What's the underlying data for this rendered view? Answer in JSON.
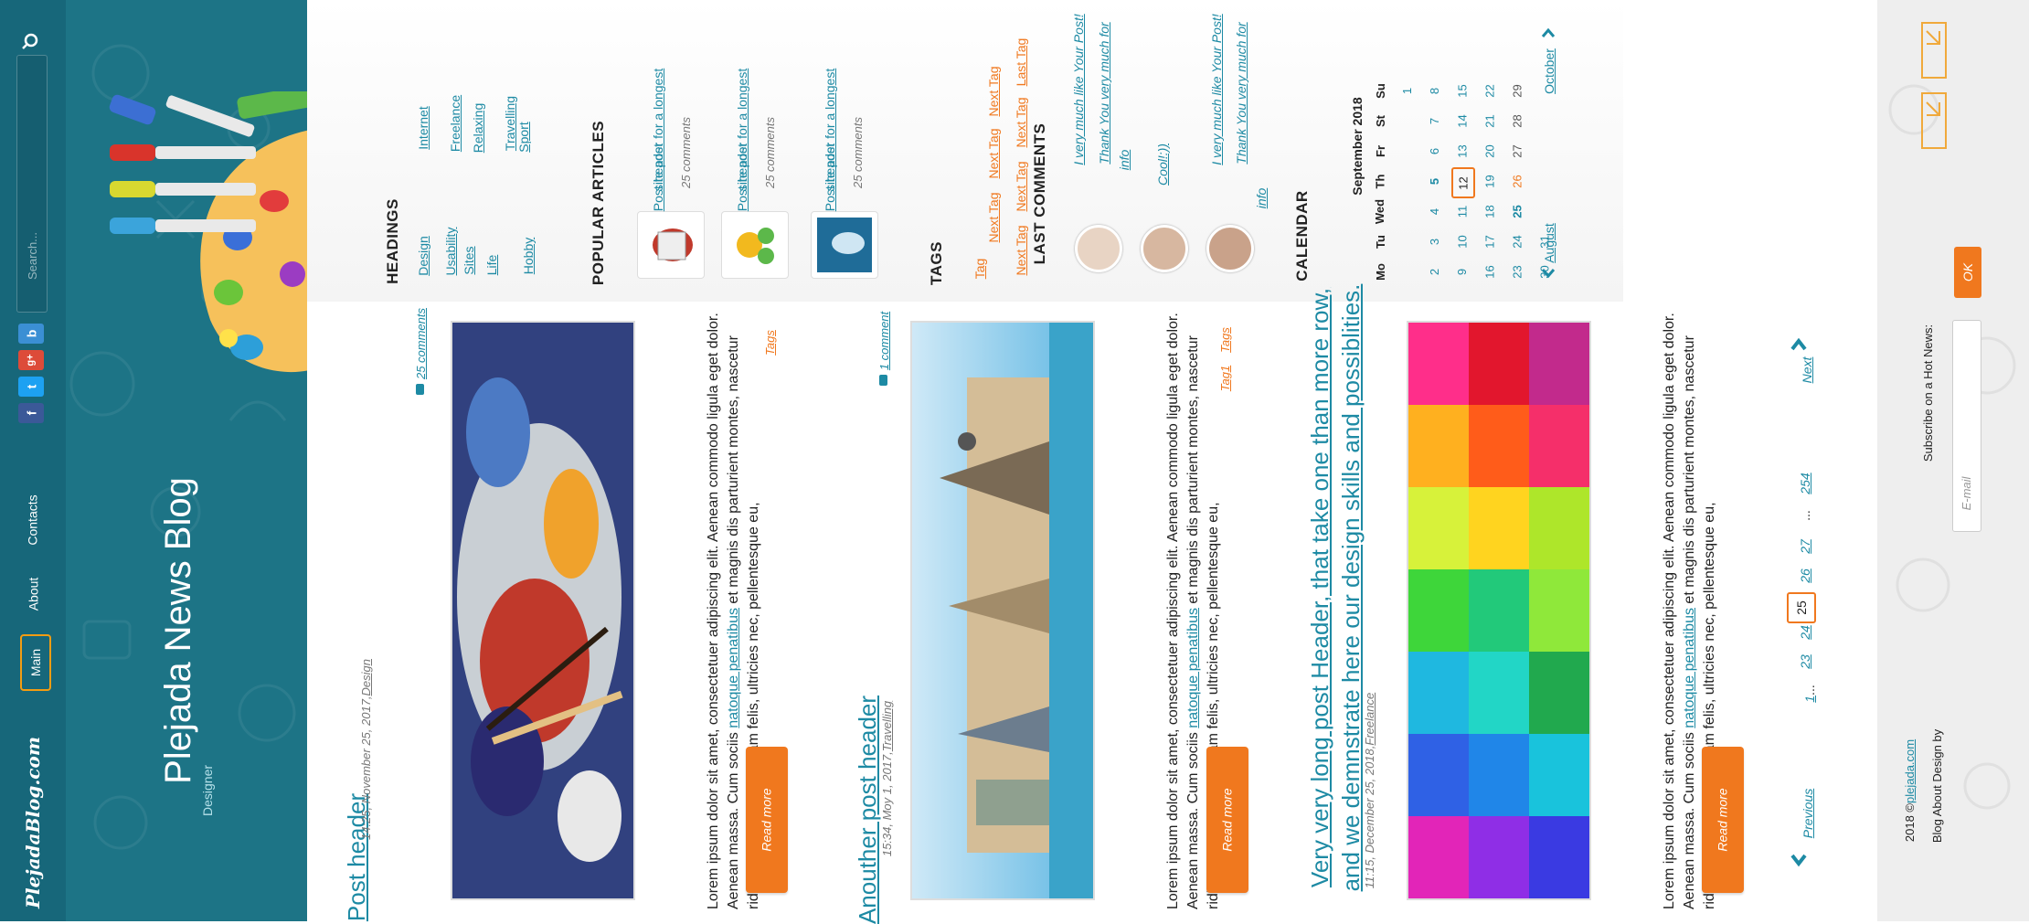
{
  "header": {
    "logo": "PlejadaBlog.com",
    "nav": [
      {
        "label": "Main",
        "active": true
      },
      {
        "label": "About",
        "active": false
      },
      {
        "label": "Contacts",
        "active": false
      }
    ],
    "search_placeholder": "Search...",
    "social": [
      "f",
      "t",
      "g+",
      "b"
    ],
    "blog_title": "Plejada News Blog",
    "blog_subtitle": "Designer"
  },
  "posts": [
    {
      "title": "Post header",
      "meta_time": "14:25, November 25, 2017, ",
      "meta_category": "Design",
      "comments": "25 comments",
      "text_before": "Lorem ipsum dolor sit amet, consectetuer adipiscing elit. Aenean commodo ligula eget dolor. Aenean massa. Cum sociis ",
      "text_link": "natoque penatibus",
      "text_after": " et magnis dis parturient montes, nascetur ridiculus mus. Donec quam felis, ultricies nec, pellentesque eu,",
      "read_more": "Read more",
      "tags": [
        "Tags"
      ]
    },
    {
      "title": "Anouther post header",
      "meta_time": "15:34, Moy 1, 2017, ",
      "meta_category": "Travelling",
      "comments": "1 comment",
      "text_before": "Lorem ipsum dolor sit amet, consectetuer adipiscing elit. Aenean commodo ligula eget dolor. Aenean massa. Cum sociis ",
      "text_link": "natoque penatibus",
      "text_after": " et magnis dis parturient montes, nascetur ridiculus mus. Donec quam felis, ultricies nec, pellentesque eu,",
      "read_more": "Read more",
      "tags": [
        "Tag1",
        "Tags"
      ]
    },
    {
      "title_line1": "Very very long post Header, that take one than more row,",
      "title_line2": "and we demnstrate here our design skills and possiblities.",
      "meta_time": "11:15, December 25, 2018, ",
      "meta_category": "Freelance",
      "text_before": "Lorem ipsum dolor sit amet, consectetuer adipiscing elit. Aenean commodo ligula eget dolor. Aenean massa. Cum sociis ",
      "text_link": "natoque penatibus",
      "text_after": " et magnis dis parturient montes, nascetur ridiculus mus. Donec quam felis, ultricies nec, pellentesque eu,",
      "read_more": "Read more"
    }
  ],
  "pagination": {
    "previous": "Previous",
    "next": "Next",
    "pages": [
      "1",
      "...",
      "23",
      "24",
      "25",
      "26",
      "27",
      "...",
      "254"
    ],
    "current": "25"
  },
  "sidebar": {
    "headings_title": "HEADINGS",
    "headings_col1": [
      "Design",
      "Usability",
      "Sites",
      "Life",
      "Hobby"
    ],
    "headings_col2": [
      "Internet",
      "Freelance",
      "Relaxing",
      "Travelling",
      "Sport"
    ],
    "popular_title": "POPULAR ARTICLES",
    "popular": [
      {
        "line1": "Post header for a longest",
        "line2": "site post",
        "comments": "25 comments"
      },
      {
        "line1": "Post header for a longest",
        "line2": "site post",
        "comments": "25 comments"
      },
      {
        "line1": "Post header for a longest",
        "line2": "site post",
        "comments": "25 comments"
      }
    ],
    "tags_title": "TAGS",
    "tags_row1": [
      "Tag",
      "Next Tag",
      "Next Tag",
      "Next Tag"
    ],
    "tags_row2": [
      "Next Tag",
      "Next Tag",
      "Next Tag",
      "Last Tag"
    ],
    "comments_title": "LAST COMMENTS",
    "comments": [
      {
        "lines": [
          "I very much like Your Post!",
          "Thank You very much for",
          "info"
        ]
      },
      {
        "lines": [
          "Cool!:))"
        ]
      },
      {
        "lines": [
          "I very much like Your Post!",
          "Thank You very much for",
          "info"
        ]
      }
    ],
    "calendar_title": "CALENDAR",
    "calendar_month": "September 2018",
    "weekdays": [
      "Mo",
      "Tu",
      "Wed",
      "Th",
      "Fr",
      "St",
      "Su"
    ],
    "weeks": [
      [
        "",
        "",
        "",
        "",
        "",
        "",
        "1"
      ],
      [
        "2",
        "3",
        "4",
        "5",
        "6",
        "7",
        "8"
      ],
      [
        "9",
        "10",
        "11",
        "12",
        "13",
        "14",
        "15"
      ],
      [
        "16",
        "17",
        "18",
        "19",
        "20",
        "21",
        "22"
      ],
      [
        "23",
        "24",
        "25",
        "26",
        "27",
        "28",
        "29"
      ],
      [
        "30",
        "31",
        "",
        "",
        "",
        "",
        ""
      ]
    ],
    "prev_month": "August",
    "next_month": "October"
  },
  "footer": {
    "subscribe_label": "Subscribe on a Hot News:",
    "email_placeholder": "E-mail",
    "ok": "OK",
    "copyright_prefix": "2018 © ",
    "copyright_link": "plejada.com",
    "design_by": "Blog About Design by"
  },
  "colors": {
    "header_bg": "#1d7486",
    "accent": "#f0781e",
    "link": "#1d8aa4"
  }
}
